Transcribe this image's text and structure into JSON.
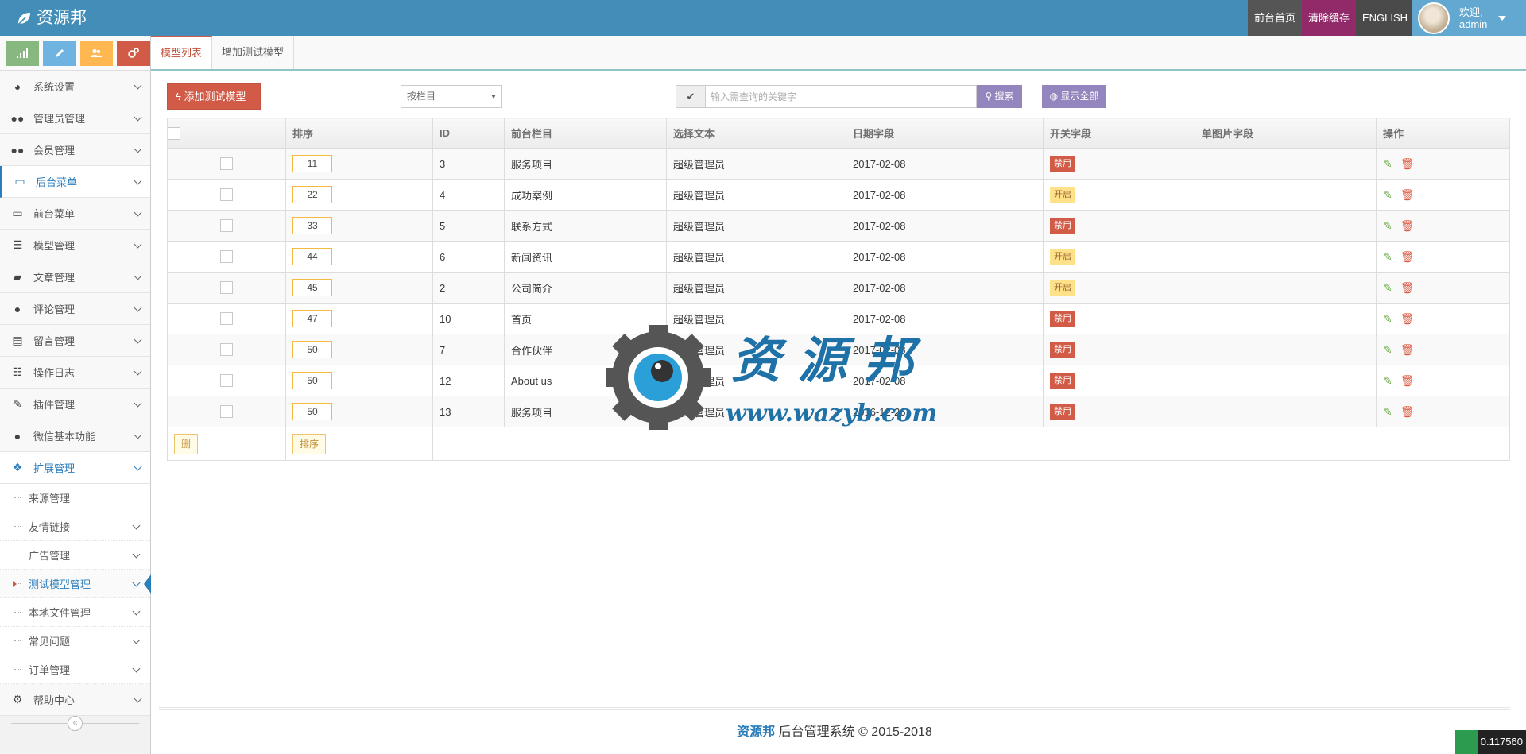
{
  "header": {
    "brand": "资源邦",
    "home_label": "前台首页",
    "cache_label": "清除缓存",
    "lang_label": "ENGLISH",
    "welcome": "欢迎,",
    "username": "admin"
  },
  "sidebar": {
    "menu": [
      {
        "label": "系统设置",
        "icon": "tachometer-icon"
      },
      {
        "label": "管理员管理",
        "icon": "users-icon"
      },
      {
        "label": "会员管理",
        "icon": "users-icon"
      },
      {
        "label": "后台菜单",
        "icon": "desktop-icon"
      },
      {
        "label": "前台菜单",
        "icon": "desktop-icon"
      },
      {
        "label": "模型管理",
        "icon": "list-icon"
      },
      {
        "label": "文章管理",
        "icon": "folder-icon"
      },
      {
        "label": "评论管理",
        "icon": "comment-icon"
      },
      {
        "label": "留言管理",
        "icon": "book-icon"
      },
      {
        "label": "操作日志",
        "icon": "tasks-icon"
      },
      {
        "label": "插件管理",
        "icon": "plug-icon"
      },
      {
        "label": "微信基本功能",
        "icon": "wechat-icon"
      },
      {
        "label": "扩展管理",
        "icon": "cubes-icon"
      }
    ],
    "submenu": [
      {
        "label": "来源管理"
      },
      {
        "label": "友情链接"
      },
      {
        "label": "广告管理"
      },
      {
        "label": "测试模型管理"
      },
      {
        "label": "本地文件管理"
      },
      {
        "label": "常见问题"
      },
      {
        "label": "订单管理"
      }
    ],
    "help": {
      "label": "帮助中心"
    }
  },
  "tabs": [
    {
      "label": "模型列表"
    },
    {
      "label": "增加测试模型"
    }
  ],
  "toolbar": {
    "add_label": "添加测试模型",
    "select_value": "按栏目",
    "search_placeholder": "输入需查询的关键字",
    "search_label": "搜索",
    "show_all_label": "显示全部"
  },
  "table": {
    "headers": [
      "排序",
      "ID",
      "前台栏目",
      "选择文本",
      "日期字段",
      "开关字段",
      "单图片字段",
      "操作"
    ],
    "rows": [
      {
        "sort": "11",
        "id": "3",
        "column": "服务项目",
        "text": "超级管理员",
        "date": "2017-02-08",
        "switch": "禁用",
        "on": false
      },
      {
        "sort": "22",
        "id": "4",
        "column": "成功案例",
        "text": "超级管理员",
        "date": "2017-02-08",
        "switch": "开启",
        "on": true
      },
      {
        "sort": "33",
        "id": "5",
        "column": "联系方式",
        "text": "超级管理员",
        "date": "2017-02-08",
        "switch": "禁用",
        "on": false
      },
      {
        "sort": "44",
        "id": "6",
        "column": "新闻资讯",
        "text": "超级管理员",
        "date": "2017-02-08",
        "switch": "开启",
        "on": true
      },
      {
        "sort": "45",
        "id": "2",
        "column": "公司简介",
        "text": "超级管理员",
        "date": "2017-02-08",
        "switch": "开启",
        "on": true
      },
      {
        "sort": "47",
        "id": "10",
        "column": "首页",
        "text": "超级管理员",
        "date": "2017-02-08",
        "switch": "禁用",
        "on": false
      },
      {
        "sort": "50",
        "id": "7",
        "column": "合作伙伴",
        "text": "超级管理员",
        "date": "2017-02-08",
        "switch": "禁用",
        "on": false
      },
      {
        "sort": "50",
        "id": "12",
        "column": "About us",
        "text": "超级管理员",
        "date": "2017-02-08",
        "switch": "禁用",
        "on": false
      },
      {
        "sort": "50",
        "id": "13",
        "column": "服务项目",
        "text": "超级管理员",
        "date": "2016-12-26",
        "switch": "禁用",
        "on": false
      }
    ],
    "delete_label": "删",
    "sort_label": "排序"
  },
  "watermark": {
    "title": "资 源 邦",
    "url": "www.wazyb.com"
  },
  "footer": {
    "brand": "资源邦",
    "text": " 后台管理系统 © 2015-2018"
  },
  "corner_number": "0.117560",
  "colors": {
    "navbar": "#438eb9",
    "accent_red": "#d15b47",
    "purple": "#9585bf",
    "active_blue": "#2b7dbc"
  }
}
